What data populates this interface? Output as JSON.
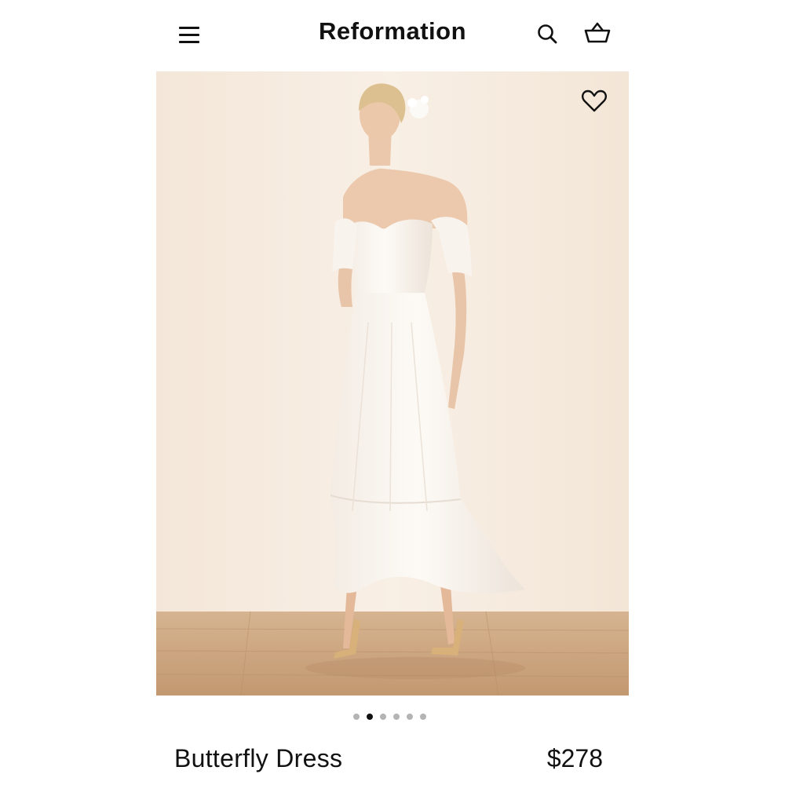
{
  "header": {
    "brand": "Reformation",
    "icons": {
      "menu": "hamburger-menu-icon",
      "search": "search-icon",
      "cart": "shopping-basket-icon"
    }
  },
  "gallery": {
    "image_subject": "model wearing white off-shoulder maxi dress",
    "favorite_icon": "heart-outline-icon",
    "image_count": 6,
    "active_index": 1
  },
  "product": {
    "name": "Butterfly Dress",
    "price": "$278"
  },
  "colors": {
    "background": "#ffffff",
    "photo_wall": "#f6ece1",
    "floor": "#c9a27f",
    "dress": "#fbf7f2",
    "dot_active": "#111111",
    "dot_inactive": "#b4b4b4"
  }
}
